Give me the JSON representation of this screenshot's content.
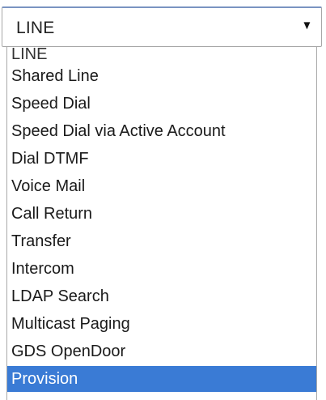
{
  "select": {
    "value": "LINE",
    "arrow_icon": "triangle-down-icon"
  },
  "options": [
    "LINE",
    "Shared Line",
    "Speed Dial",
    "Speed Dial via Active Account",
    "Dial DTMF",
    "Voice Mail",
    "Call Return",
    "Transfer",
    "Intercom",
    "LDAP Search",
    "Multicast Paging",
    "GDS OpenDoor",
    "Provision"
  ],
  "highlighted_option": "Provision",
  "colors": {
    "highlight": "#3a7bd5",
    "highlight_text": "#ffffff",
    "border": "#a9a9a9"
  }
}
